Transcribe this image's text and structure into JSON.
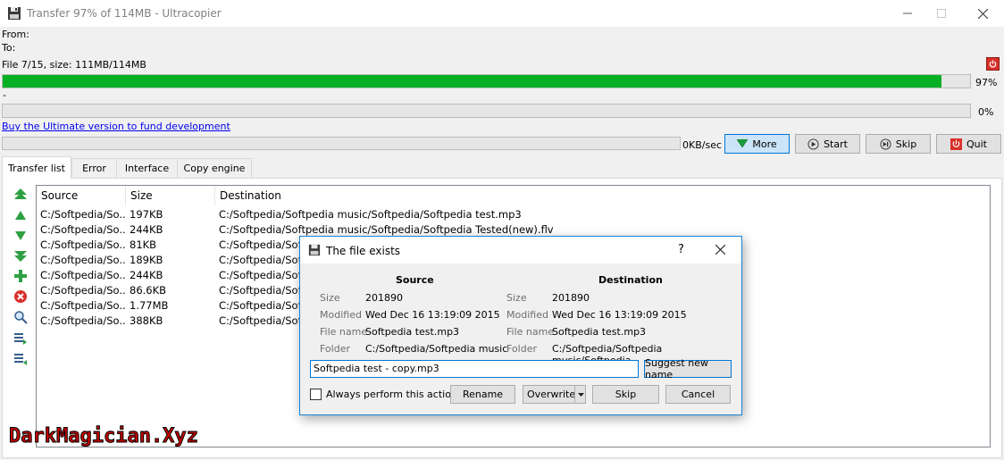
{
  "window": {
    "title": "Transfer 97% of 114MB - Ultracopier",
    "minimize_icon": "minimize-icon",
    "maximize_icon": "maximize-icon",
    "close_icon": "close-icon"
  },
  "info": {
    "from_label": "From:",
    "to_label": "To:",
    "file_info": "File 7/15, size: 111MB/114MB"
  },
  "progress": {
    "overall_fraction": 0.97,
    "overall_text": "97%",
    "current_file_label": "-",
    "current_fraction": 0.0,
    "current_text": "0%"
  },
  "promo_link": "Buy the Ultimate version to fund development",
  "speed": {
    "speed_text": "0KB/sec"
  },
  "buttons": {
    "more": "More",
    "start": "Start",
    "skip": "Skip",
    "quit": "Quit"
  },
  "tabs": [
    "Transfer list",
    "Error",
    "Interface",
    "Copy engine"
  ],
  "table": {
    "headers": [
      "Source",
      "Size",
      "Destination"
    ],
    "rows": [
      [
        "C:/Softpedia/So...",
        "197KB",
        "C:/Softpedia/Softpedia music/Softpedia/Softpedia test.mp3"
      ],
      [
        "C:/Softpedia/So...",
        "244KB",
        "C:/Softpedia/Softpedia music/Softpedia/Softpedia Tested(new).flv"
      ],
      [
        "C:/Softpedia/So...",
        "81KB",
        "C:/Softpedia/Soft"
      ],
      [
        "C:/Softpedia/So...",
        "189KB",
        "C:/Softpedia/Soft"
      ],
      [
        "C:/Softpedia/So...",
        "244KB",
        "C:/Softpedia/Soft"
      ],
      [
        "C:/Softpedia/So...",
        "86.6KB",
        "C:/Softpedia/Soft"
      ],
      [
        "C:/Softpedia/So...",
        "1.77MB",
        "C:/Softpedia/Soft"
      ],
      [
        "C:/Softpedia/So...",
        "388KB",
        "C:/Softpedia/Soft"
      ]
    ]
  },
  "dialog": {
    "title": "The file exists",
    "help": "?",
    "source_header": "Source",
    "destination_header": "Destination",
    "labels": {
      "size": "Size",
      "modified": "Modified",
      "file_name": "File name",
      "folder": "Folder"
    },
    "source": {
      "size": "201890",
      "modified": "Wed Dec 16 13:19:09 2015",
      "file_name": "Softpedia test.mp3",
      "folder": "C:/Softpedia/Softpedia music"
    },
    "destination": {
      "size": "201890",
      "modified": "Wed Dec 16 13:19:09 2015",
      "file_name": "Softpedia test.mp3",
      "folder": "C:/Softpedia/Softpedia music/Softpedia"
    },
    "new_name_value": "Softpedia test - copy.mp3",
    "suggest_button": "Suggest new name",
    "always_label": "Always perform this action",
    "always_checked": false,
    "rename_button": "Rename",
    "overwrite_button": "Overwrite",
    "skip_button": "Skip",
    "cancel_button": "Cancel"
  },
  "watermark": "DarkMagician.Xyz",
  "colors": {
    "progress_green": "#06b025",
    "link_blue": "#0000ee",
    "accent": "#0078d7",
    "watermark_red": "#c80000"
  }
}
